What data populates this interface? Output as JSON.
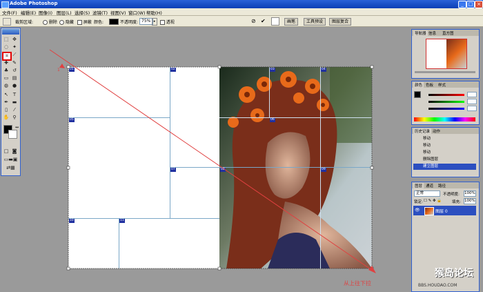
{
  "window": {
    "title": "Adobe Photoshop",
    "min_label": "_",
    "max_label": "□",
    "close_label": "×"
  },
  "menu": [
    "文件(F)",
    "编辑(E)",
    "图像(I)",
    "图层(L)",
    "选择(S)",
    "滤镜(T)",
    "视图(V)",
    "窗口(W)",
    "帮助(H)"
  ],
  "options": {
    "crop_area_label": "裁剪区域:",
    "delete_label": "删除",
    "hide_label": "隐藏",
    "shield_label": "屏蔽",
    "color_label": "颜色:",
    "opacity_label": "不透明度:",
    "opacity_value": "75%",
    "perspective_label": "透视",
    "tabs": [
      "画笔",
      "工具预设",
      "图层复合"
    ]
  },
  "navigator": {
    "tabs": [
      "导航器",
      "信息",
      "直方图"
    ]
  },
  "color_panel": {
    "tabs": [
      "颜色",
      "色板",
      "样式"
    ]
  },
  "history": {
    "tabs": [
      "历史记录",
      "动作"
    ],
    "items": [
      "移动",
      "移动",
      "移动",
      "删除图层",
      "建立图层"
    ],
    "active_index": 4
  },
  "layers": {
    "tabs": [
      "图层",
      "通道",
      "路径"
    ],
    "blend_mode": "正常",
    "opacity_label": "不透明度:",
    "opacity_value": "100%",
    "lock_label": "锁定:",
    "fill_label": "填充:",
    "fill_value": "100%",
    "layer_name": "图层 0"
  },
  "slice_badges": [
    "01",
    "02",
    "03",
    "04",
    "05",
    "06",
    "07",
    "08",
    "09",
    "10",
    "11"
  ],
  "annotation": {
    "text": "从上往下拉",
    "color": "#e04040"
  },
  "watermark": {
    "main": "猴岛论坛",
    "url": "BBS.HOUDAO.COM"
  },
  "colors": {
    "accent": "#3060d0",
    "annotation": "#e04040",
    "slice": "#2030a0"
  }
}
